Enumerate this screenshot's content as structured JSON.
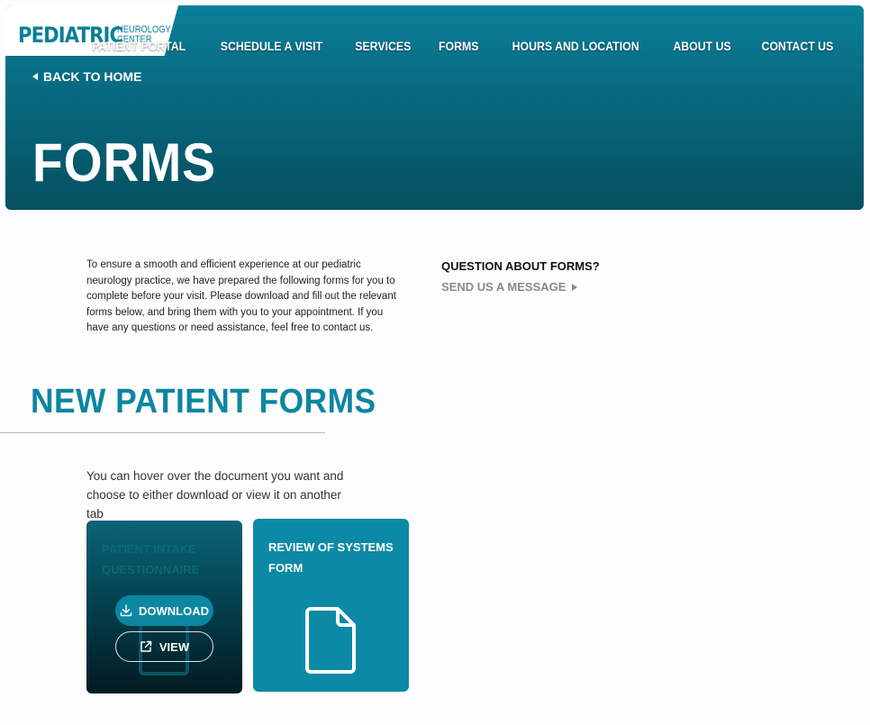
{
  "brand": {
    "name": "PEDIATRIC",
    "subtitle": "NEUROLOGY CENTER",
    "accent": "#0b86a1"
  },
  "nav": {
    "items": [
      "PATIENT PORTAL",
      "SCHEDULE A VISIT",
      "SERVICES",
      "FORMS",
      "HOURS AND LOCATION",
      "ABOUT US",
      "CONTACT US"
    ]
  },
  "hero": {
    "back_label": "BACK TO HOME",
    "title": "FORMS"
  },
  "intro": {
    "text": "To ensure a smooth and efficient experience at our pediatric neurology practice, we have prepared the following forms for you to complete before your visit. Please download and fill out the relevant forms below, and bring them with you to your appointment. If you have any questions or need assistance, feel free to contact us."
  },
  "question": {
    "title": "QUESTION ABOUT FORMS?",
    "link": "SEND US A MESSAGE"
  },
  "section": {
    "title": "NEW PATIENT FORMS",
    "hint": "You can hover over the document you want and choose to either download or view it on another tab"
  },
  "forms": [
    {
      "title": "PATIENT INTAKE QUESTIONNAIRE",
      "download_label": "DOWNLOAD",
      "view_label": "VIEW",
      "icon": "document-icon"
    },
    {
      "title": "REVIEW OF SYSTEMS FORM",
      "icon": "document-icon"
    }
  ]
}
